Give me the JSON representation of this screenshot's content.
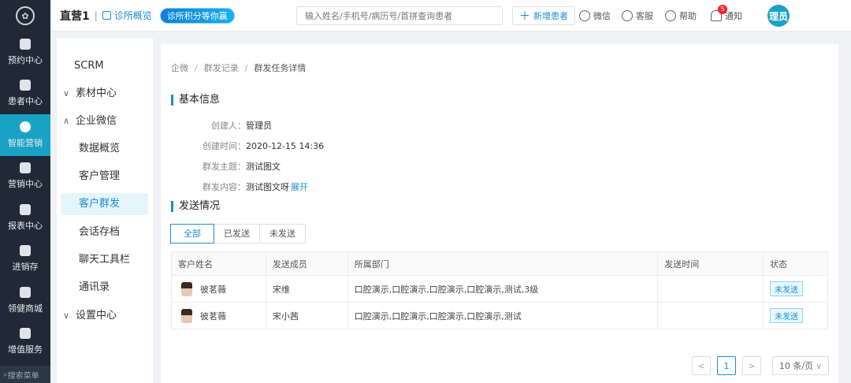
{
  "rail": {
    "items": [
      {
        "label": "预约中心",
        "icon": "calendar-icon"
      },
      {
        "label": "患者中心",
        "icon": "user-icon"
      },
      {
        "label": "智能营销",
        "icon": "marketing-icon"
      },
      {
        "label": "营销中心",
        "icon": "fan-icon"
      },
      {
        "label": "报表中心",
        "icon": "bar-chart-icon"
      },
      {
        "label": "进销存",
        "icon": "layers-icon"
      },
      {
        "label": "领健商城",
        "icon": "store-icon"
      },
      {
        "label": "增值服务",
        "icon": "grid-icon"
      }
    ],
    "active_index": 2,
    "search_label": "搜索菜单"
  },
  "header": {
    "clinic": "直营1",
    "separator": "|",
    "overview": "诊所概览",
    "banner": "诊所积分等你赢",
    "search_placeholder": "输入姓名/手机号/病历号/首拼查询患者",
    "new_patient": "新增患者",
    "wechat": "微信",
    "service": "客服",
    "help": "帮助",
    "notify": "通知",
    "notify_count": "5",
    "avatar": "理员"
  },
  "submenu": {
    "scrm": "SCRM",
    "material": "素材中心",
    "wecom": "企业微信",
    "data_overview": "数据概览",
    "customer_manage": "客户管理",
    "customer_broadcast": "客户群发",
    "session_archive": "会话存档",
    "chat_toolbar": "聊天工具栏",
    "contacts": "通讯录",
    "settings": "设置中心",
    "expand_arrow": "∨",
    "collapse_arrow": "∧"
  },
  "breadcrumb": {
    "items": [
      "企微",
      "群发记录",
      "群发任务详情"
    ],
    "separator": "/"
  },
  "basic": {
    "title": "基本信息",
    "creator_label": "创建人：",
    "creator": "管理员",
    "time_label": "创建时间：",
    "time": "2020-12-15 14:36",
    "subject_label": "群发主题：",
    "subject": "测试图文",
    "content_label": "群发内容：",
    "content": "测试图文呀",
    "expand": "展开"
  },
  "send": {
    "title": "发送情况",
    "tabs": [
      "全部",
      "已发送",
      "未发送"
    ],
    "active_tab": 0,
    "columns": [
      "客户姓名",
      "发送成员",
      "所属部门",
      "发送时间",
      "状态"
    ],
    "rows": [
      {
        "customer": "彼茗薇",
        "member": "宋维",
        "dept": "口腔演示,口腔演示,口腔演示,口腔演示,测试,3级",
        "time": "",
        "status": "未发送"
      },
      {
        "customer": "彼茗薇",
        "member": "宋小茜",
        "dept": "口腔演示,口腔演示,口腔演示,口腔演示,测试",
        "time": "",
        "status": "未发送"
      }
    ]
  },
  "pager": {
    "prev": "<",
    "page": "1",
    "next": ">",
    "size": "10 条/页"
  },
  "colors": {
    "accent": "#1a8fd0",
    "rail_bg": "#1f2a36",
    "rail_active": "#1aa2c4"
  }
}
